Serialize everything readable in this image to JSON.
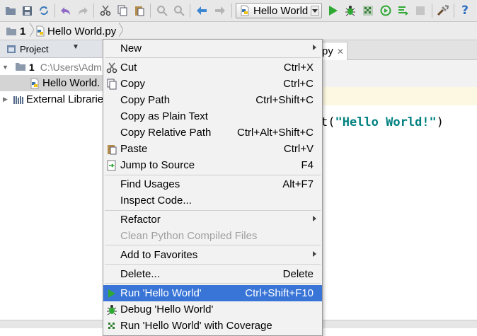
{
  "toolbar": {
    "run_config": "Hello World"
  },
  "navbar": {
    "project": "1",
    "file": "Hello World.py"
  },
  "project_panel": {
    "title": "Project",
    "root_name": "1",
    "root_path": "C:\\Users\\Adm",
    "file": "Hello World.",
    "external": "External Librarie"
  },
  "editor": {
    "tab_label": "py",
    "code_prefix": "t(",
    "code_string": "\"Hello World!\"",
    "code_suffix": ")"
  },
  "menu": {
    "new": "New",
    "cut": "Cut",
    "cut_sc": "Ctrl+X",
    "copy": "Copy",
    "copy_sc": "Ctrl+C",
    "copy_path": "Copy Path",
    "copy_path_sc": "Ctrl+Shift+C",
    "copy_plain": "Copy as Plain Text",
    "copy_relative": "Copy Relative Path",
    "copy_relative_sc": "Ctrl+Alt+Shift+C",
    "paste": "Paste",
    "paste_sc": "Ctrl+V",
    "jump": "Jump to Source",
    "jump_sc": "F4",
    "find_usages": "Find Usages",
    "find_usages_sc": "Alt+F7",
    "inspect": "Inspect Code...",
    "refactor": "Refactor",
    "clean": "Clean Python Compiled Files",
    "favorites": "Add to Favorites",
    "delete": "Delete...",
    "delete_sc": "Delete",
    "run": "Run 'Hello World'",
    "run_sc": "Ctrl+Shift+F10",
    "debug": "Debug 'Hello World'",
    "coverage": "Run 'Hello World' with Coverage"
  },
  "colors": {
    "selection": "#3875d7",
    "run_green": "#2fa834",
    "menu_bg": "#f2f2f2"
  }
}
